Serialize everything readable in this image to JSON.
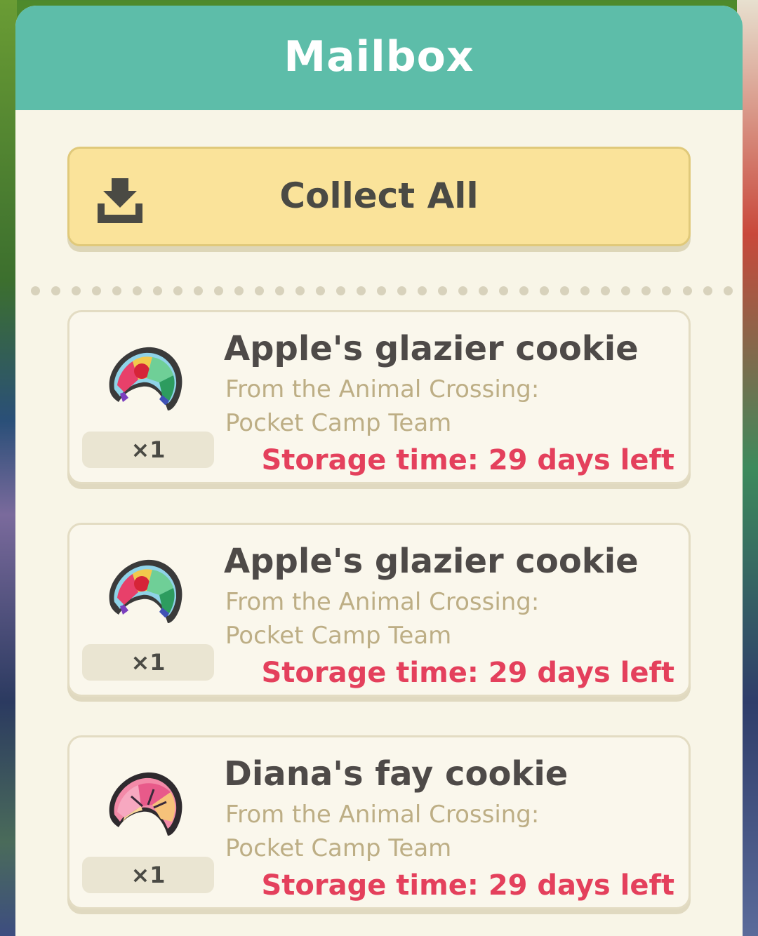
{
  "mailbox": {
    "title": "Mailbox",
    "collect_all_label": "Collect All",
    "items": [
      {
        "name": "Apple's glazier cookie",
        "from": "From the Animal Crossing: Pocket Camp Team",
        "quantity": "×1",
        "storage": "Storage time: 29 days left",
        "icon": "glazier-cookie-icon"
      },
      {
        "name": "Apple's glazier cookie",
        "from": "From the Animal Crossing: Pocket Camp Team",
        "quantity": "×1",
        "storage": "Storage time: 29 days left",
        "icon": "glazier-cookie-icon"
      },
      {
        "name": "Diana's fay cookie",
        "from": "From the Animal Crossing: Pocket Camp Team",
        "quantity": "×1",
        "storage": "Storage time: 29 days left",
        "icon": "fay-cookie-icon"
      }
    ]
  },
  "colors": {
    "header": "#5dbda9",
    "panel": "#f8f5e7",
    "button": "#fae39a",
    "storage_text": "#e4405c",
    "from_text": "#bdae85"
  }
}
